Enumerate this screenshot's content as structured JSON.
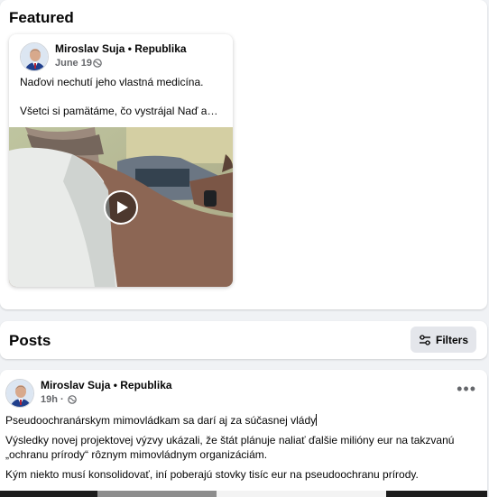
{
  "featured": {
    "title": "Featured",
    "post": {
      "author": "Miroslav Suja • Republika",
      "date": "June 19",
      "text_line1": "Naďovi nechutí jeho vlastná medicína.",
      "text_line2": "Všetci si pamätáme, čo vystrájal Naď a…",
      "media": "video"
    }
  },
  "posts_section": {
    "title": "Posts",
    "filters_label": "Filters"
  },
  "post": {
    "author": "Miroslav Suja • Republika",
    "time": "19h",
    "more_label": "•••",
    "headline": "Pseudoochranárskym mimovládkam sa darí aj za súčasnej vlády",
    "paragraph1_line1": "Výsledky novej projektovej výzvy ukázali, že štát plánuje naliať ďalšie milióny eur na takzvanú",
    "paragraph1_line2": "„ochranu prírody“ rôznym mimovládnym organizáciám.",
    "paragraph2": "Kým niekto musí konsolidovať, iní poberajú stovky tisíc eur na pseudoochranu prírody."
  },
  "colors": {
    "page_bg": "#f0f2f5",
    "card_bg": "#ffffff",
    "secondary_text": "#65676b",
    "button_bg": "#e4e6eb"
  },
  "icons": [
    "globe-icon",
    "play-icon",
    "filters-icon",
    "more-icon"
  ]
}
